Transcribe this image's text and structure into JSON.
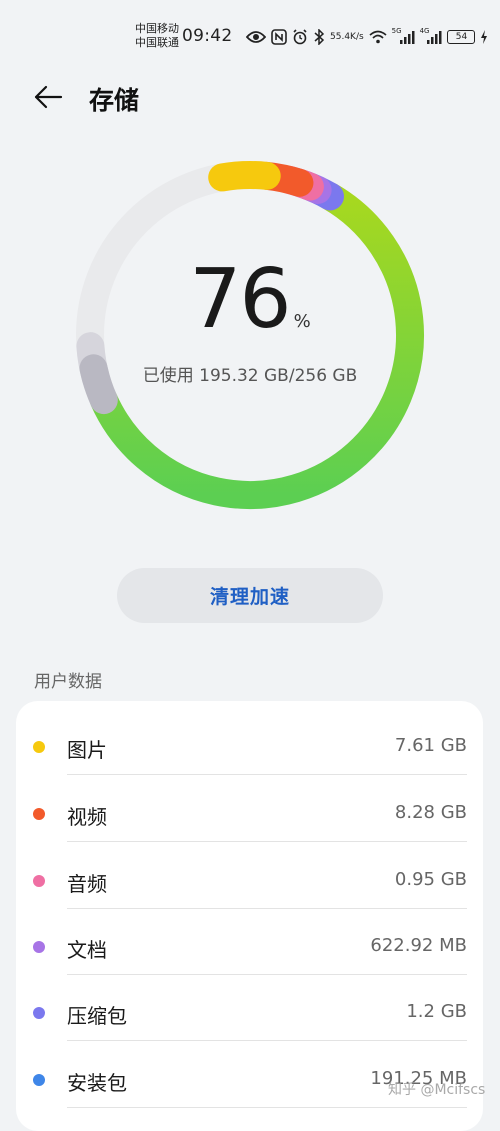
{
  "status_bar": {
    "carrier_1": "中国移动",
    "carrier_2": "中国联通",
    "time": "09:42",
    "net_speed_value": "55.4",
    "net_speed_unit": "K/s",
    "signal_1_label": "5G",
    "signal_2_label": "4G",
    "battery": "54",
    "icons": [
      "eye-icon",
      "nfc-icon",
      "alarm-icon",
      "bluetooth-icon",
      "wifi-icon",
      "signal-icon",
      "signal-icon",
      "battery-icon",
      "charging-icon"
    ]
  },
  "header": {
    "back_icon": "arrow-left-icon",
    "title": "存储"
  },
  "storage": {
    "percent": "76",
    "percent_sign": "%",
    "used_text": "已使用 195.32 GB/256 GB",
    "used_fraction": 0.76
  },
  "clean_button": {
    "label": "清理加速"
  },
  "section": {
    "title": "用户数据"
  },
  "categories": [
    {
      "name": "图片",
      "size": "7.61 GB",
      "color": "#f6c90e"
    },
    {
      "name": "视频",
      "size": "8.28 GB",
      "color": "#f25a2b"
    },
    {
      "name": "音频",
      "size": "0.95 GB",
      "color": "#ef6fa3"
    },
    {
      "name": "文档",
      "size": "622.92 MB",
      "color": "#a774e6"
    },
    {
      "name": "压缩包",
      "size": "1.2 GB",
      "color": "#7b78ee"
    },
    {
      "name": "安装包",
      "size": "191.25 MB",
      "color": "#3f86e8"
    }
  ],
  "ring_colors": {
    "track": "#e9eaec",
    "apps": "#7ed321",
    "system": "#b9b8c2",
    "system_light": "#d6d5dc"
  },
  "watermark": "知乎 @Mcifscs"
}
